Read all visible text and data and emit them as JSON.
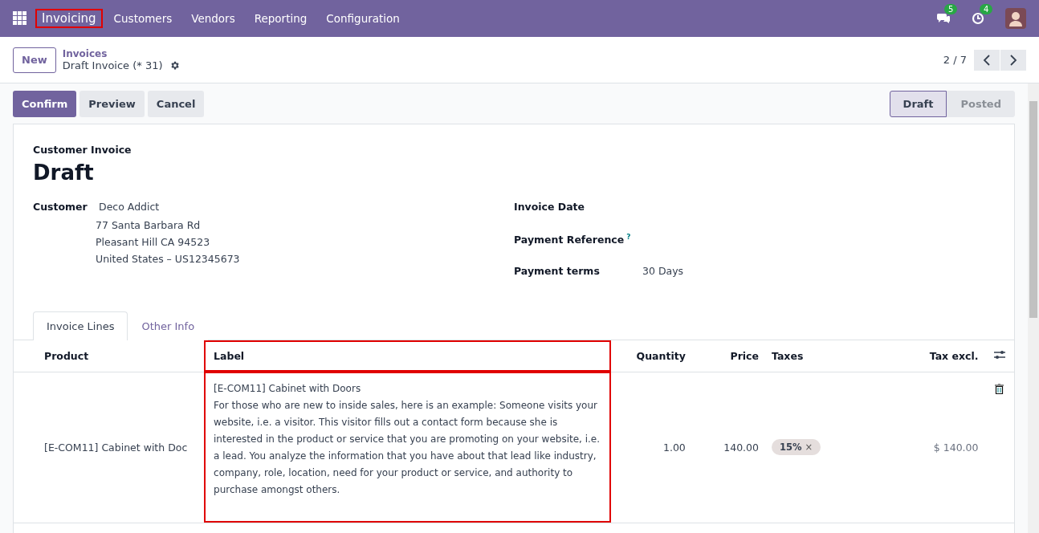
{
  "navbar": {
    "menu": [
      {
        "label": "Invoicing",
        "kind": "app",
        "highlighted": true
      },
      {
        "label": "Customers",
        "kind": "menu",
        "highlighted": false
      },
      {
        "label": "Vendors",
        "kind": "menu",
        "highlighted": false
      },
      {
        "label": "Reporting",
        "kind": "menu",
        "highlighted": false
      },
      {
        "label": "Configuration",
        "kind": "menu",
        "highlighted": false
      }
    ],
    "messages_count": "5",
    "activities_count": "4"
  },
  "control_panel": {
    "new_button": "New",
    "breadcrumb": "Invoices",
    "record_title": "Draft Invoice (* 31)",
    "pager": "2 / 7"
  },
  "actions": [
    {
      "label": "Confirm",
      "primary": true
    },
    {
      "label": "Preview",
      "primary": false
    },
    {
      "label": "Cancel",
      "primary": false
    }
  ],
  "statusbar": [
    {
      "label": "Draft",
      "selected": true
    },
    {
      "label": "Posted",
      "selected": false
    }
  ],
  "form": {
    "type_label": "Customer Invoice",
    "name": "Draft",
    "customer_label": "Customer",
    "customer_name": "Deco Addict",
    "address": [
      "77 Santa Barbara Rd",
      "Pleasant Hill CA 94523",
      "United States – US12345673"
    ],
    "right_fields": [
      {
        "label": "Invoice Date"
      },
      {
        "label": "Payment Reference",
        "help": "?"
      },
      {
        "label": "Payment terms",
        "value": "30 Days"
      }
    ]
  },
  "tabs": [
    {
      "label": "Invoice Lines",
      "selected": true
    },
    {
      "label": "Other Info",
      "selected": false
    }
  ],
  "table": {
    "columns": [
      {
        "label": "Product",
        "highlighted": false
      },
      {
        "label": "Label",
        "highlighted": true
      },
      {
        "label": "Quantity",
        "highlighted": false
      },
      {
        "label": "Price",
        "highlighted": false
      },
      {
        "label": "Taxes",
        "highlighted": false
      },
      {
        "label": "Tax excl.",
        "highlighted": false
      }
    ],
    "rows": [
      {
        "product": "[E-COM11] Cabinet with Doc",
        "label_title": "[E-COM11] Cabinet with Doors",
        "label_description": "For those who are new to inside sales, here is an example: Someone visits your website, i.e. a visitor. This visitor fills out a contact form because she is interested in the product or service that you are promoting on your website, i.e. a lead. You analyze the information that you have about that lead like industry, company, role, location, need for your product or service, and authority to purchase amongst others.",
        "quantity": "1.00",
        "price": "140.00",
        "taxes": [
          {
            "label": "15%",
            "remove": "×"
          }
        ],
        "subtotal": "$ 140.00"
      }
    ]
  }
}
